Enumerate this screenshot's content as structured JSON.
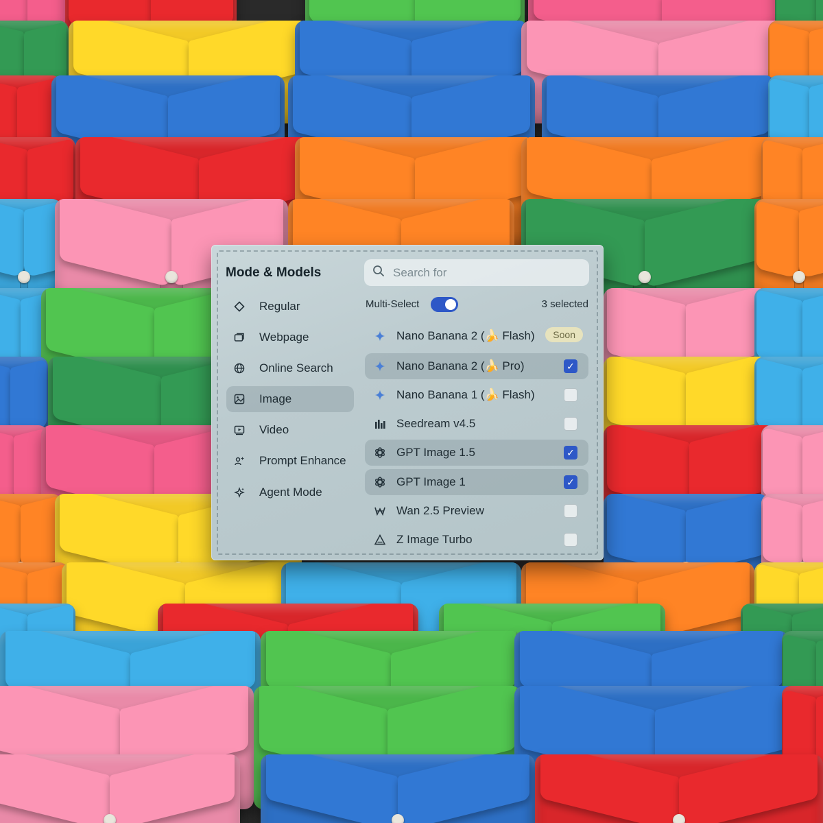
{
  "panel": {
    "title": "Mode & Models",
    "sidebar": {
      "items": [
        {
          "label": "Regular",
          "icon": "diamond-icon",
          "active": false
        },
        {
          "label": "Webpage",
          "icon": "webpage-icon",
          "active": false
        },
        {
          "label": "Online Search",
          "icon": "globe-icon",
          "active": false
        },
        {
          "label": "Image",
          "icon": "image-icon",
          "active": true
        },
        {
          "label": "Video",
          "icon": "video-icon",
          "active": false
        },
        {
          "label": "Prompt Enhance",
          "icon": "prompt-enhance-icon",
          "active": false
        },
        {
          "label": "Agent Mode",
          "icon": "sparkles-icon",
          "active": false
        }
      ]
    },
    "search": {
      "placeholder": "Search for",
      "value": ""
    },
    "multi_select": {
      "label": "Multi-Select",
      "enabled": true
    },
    "selected_count": "3 selected",
    "models": [
      {
        "label": "Nano Banana 2 (🍌 Flash)",
        "icon": "gemini-sparkle-icon",
        "checked": false,
        "badge": "Soon",
        "highlighted": false
      },
      {
        "label": "Nano Banana 2 (🍌 Pro)",
        "icon": "gemini-sparkle-icon",
        "checked": true,
        "badge": "",
        "highlighted": true
      },
      {
        "label": "Nano Banana 1 (🍌 Flash)",
        "icon": "gemini-sparkle-icon",
        "checked": false,
        "badge": "",
        "highlighted": false
      },
      {
        "label": "Seedream v4.5",
        "icon": "seedream-bars-icon",
        "checked": false,
        "badge": "",
        "highlighted": false
      },
      {
        "label": "GPT Image 1.5",
        "icon": "openai-icon",
        "checked": true,
        "badge": "",
        "highlighted": true
      },
      {
        "label": "GPT Image 1",
        "icon": "openai-icon",
        "checked": true,
        "badge": "",
        "highlighted": true
      },
      {
        "label": "Wan 2.5 Preview",
        "icon": "wan-icon",
        "checked": false,
        "badge": "",
        "highlighted": false
      },
      {
        "label": "Z Image Turbo",
        "icon": "triangle-icon",
        "checked": false,
        "badge": "",
        "highlighted": false
      }
    ]
  },
  "colors": {
    "accent": "#2e58c7",
    "panel_bg": "#bfcdd1",
    "shirt_palette": [
      "#d8262a",
      "#f2c926",
      "#2f8f4e",
      "#2d6fc4",
      "#f07a22",
      "#e98aa8",
      "#3aa3d8",
      "#e25782",
      "#4bb64a"
    ]
  }
}
